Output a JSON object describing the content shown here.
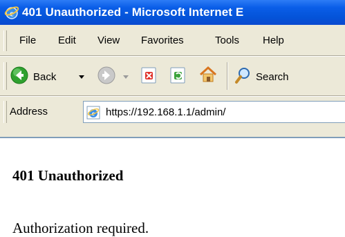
{
  "window": {
    "title": "401 Unauthorized - Microsoft Internet E"
  },
  "menubar": {
    "items": [
      "File",
      "Edit",
      "View",
      "Favorites",
      "Tools",
      "Help"
    ]
  },
  "toolbar": {
    "back_label": "Back",
    "search_label": "Search",
    "icons": [
      "back-arrow-icon",
      "forward-arrow-icon",
      "stop-icon",
      "refresh-icon",
      "home-icon",
      "search-icon"
    ]
  },
  "address": {
    "label": "Address",
    "url": "https://192.168.1.1/admin/"
  },
  "page": {
    "heading": "401 Unauthorized",
    "message": "Authorization required."
  },
  "colors": {
    "titlebar": "#0453d8",
    "chrome": "#ece9d8",
    "back_button_green": "#2fa12f",
    "border_blue": "#7f9db9"
  }
}
